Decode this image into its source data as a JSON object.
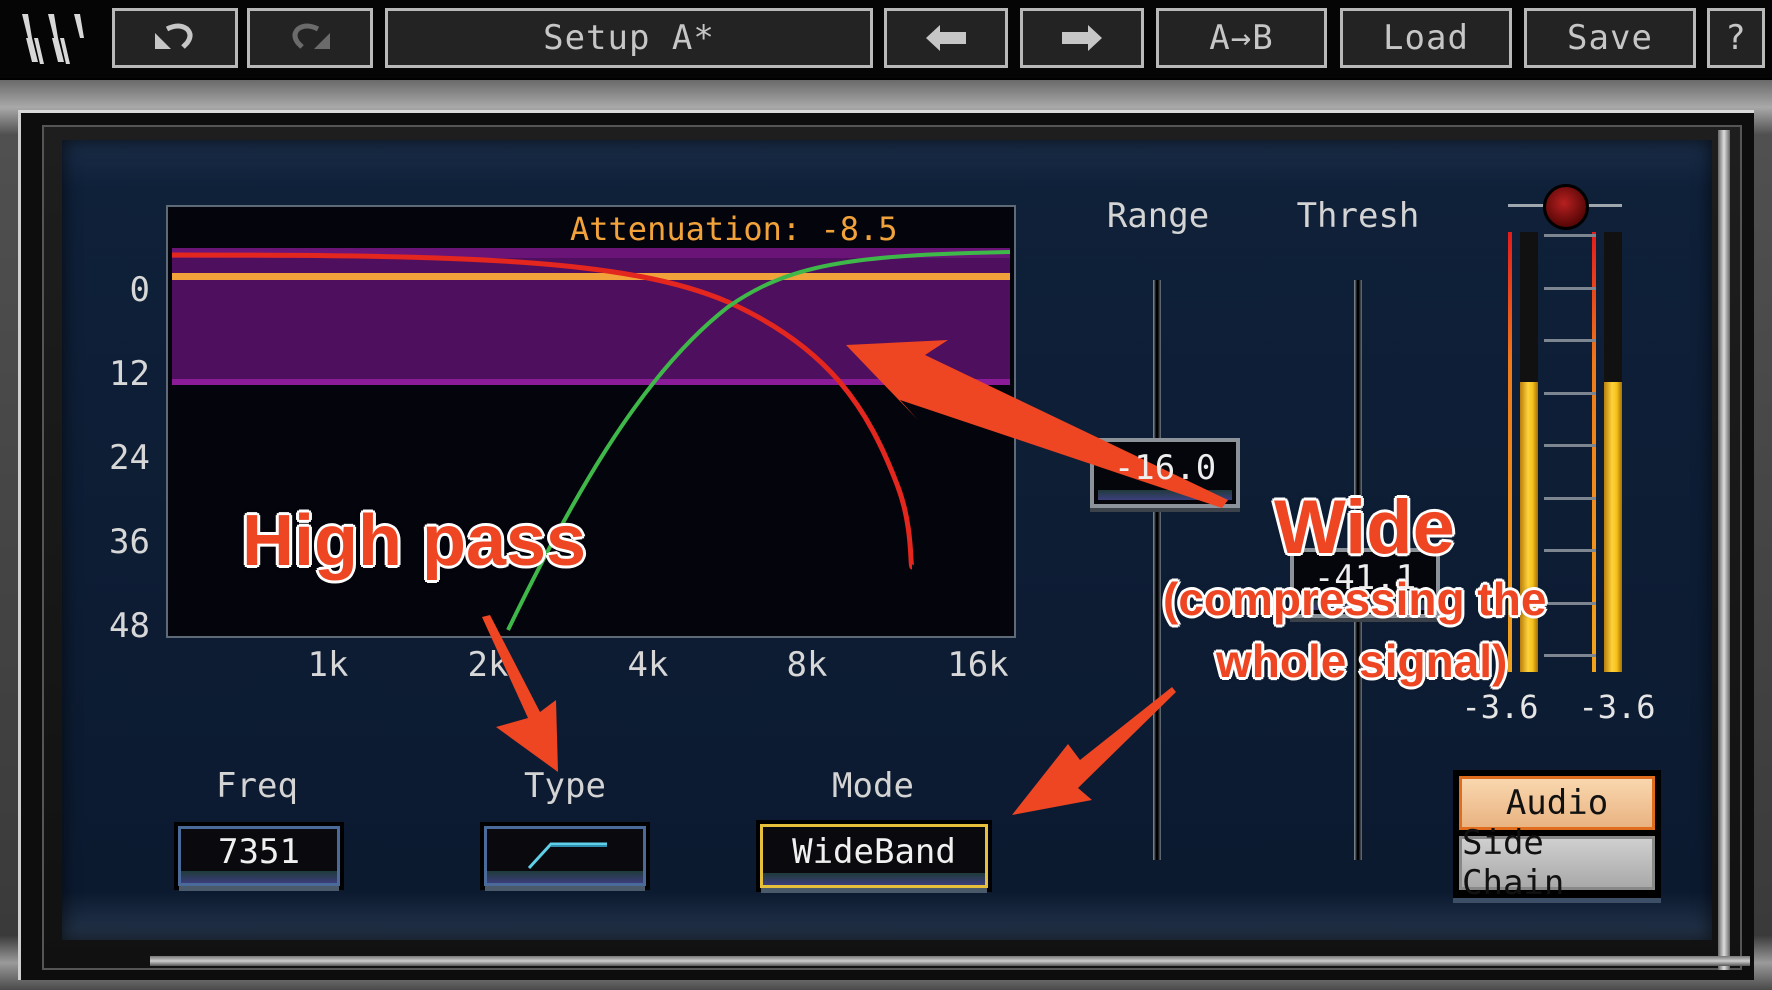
{
  "toolbar": {
    "undo_icon": "undo-arrow",
    "redo_icon": "redo-arrow",
    "setup_label": "Setup A*",
    "prev_icon": "arrow-left",
    "next_icon": "arrow-right",
    "copy_label": "A→B",
    "load_label": "Load",
    "save_label": "Save",
    "help_label": "?"
  },
  "graph": {
    "attenuation_label": "Attenuation: -8.5",
    "y_ticks": [
      "0",
      "12",
      "24",
      "36",
      "48"
    ],
    "x_ticks": [
      "1k",
      "2k",
      "4k",
      "8k",
      "16k"
    ],
    "colors": {
      "band": "#4e0f5e",
      "band_edge": "#8b1b96",
      "threshold_line": "#f2a23a",
      "red_curve": "#e3261e",
      "green_curve": "#3fb84a"
    }
  },
  "controls": {
    "freq": {
      "label": "Freq",
      "value": "7351"
    },
    "type": {
      "label": "Type",
      "icon": "high-pass-filter-shape"
    },
    "mode": {
      "label": "Mode",
      "value": "WideBand"
    }
  },
  "sliders": {
    "range": {
      "label": "Range",
      "value": "-16.0"
    },
    "thresh": {
      "label": "Thresh",
      "value": "-41.1"
    }
  },
  "meters": {
    "left_value": "-3.6",
    "right_value": "-3.6",
    "left_level": 0.66,
    "right_level": 0.66
  },
  "source": {
    "audio_label": "Audio",
    "sidechain_label": "Side Chain",
    "selected": "Audio"
  },
  "annotations": {
    "high_pass": "High pass",
    "wide_title": "Wide",
    "wide_line1": "(compressing the",
    "wide_line2": "whole signal)",
    "color": "#ee4523"
  }
}
